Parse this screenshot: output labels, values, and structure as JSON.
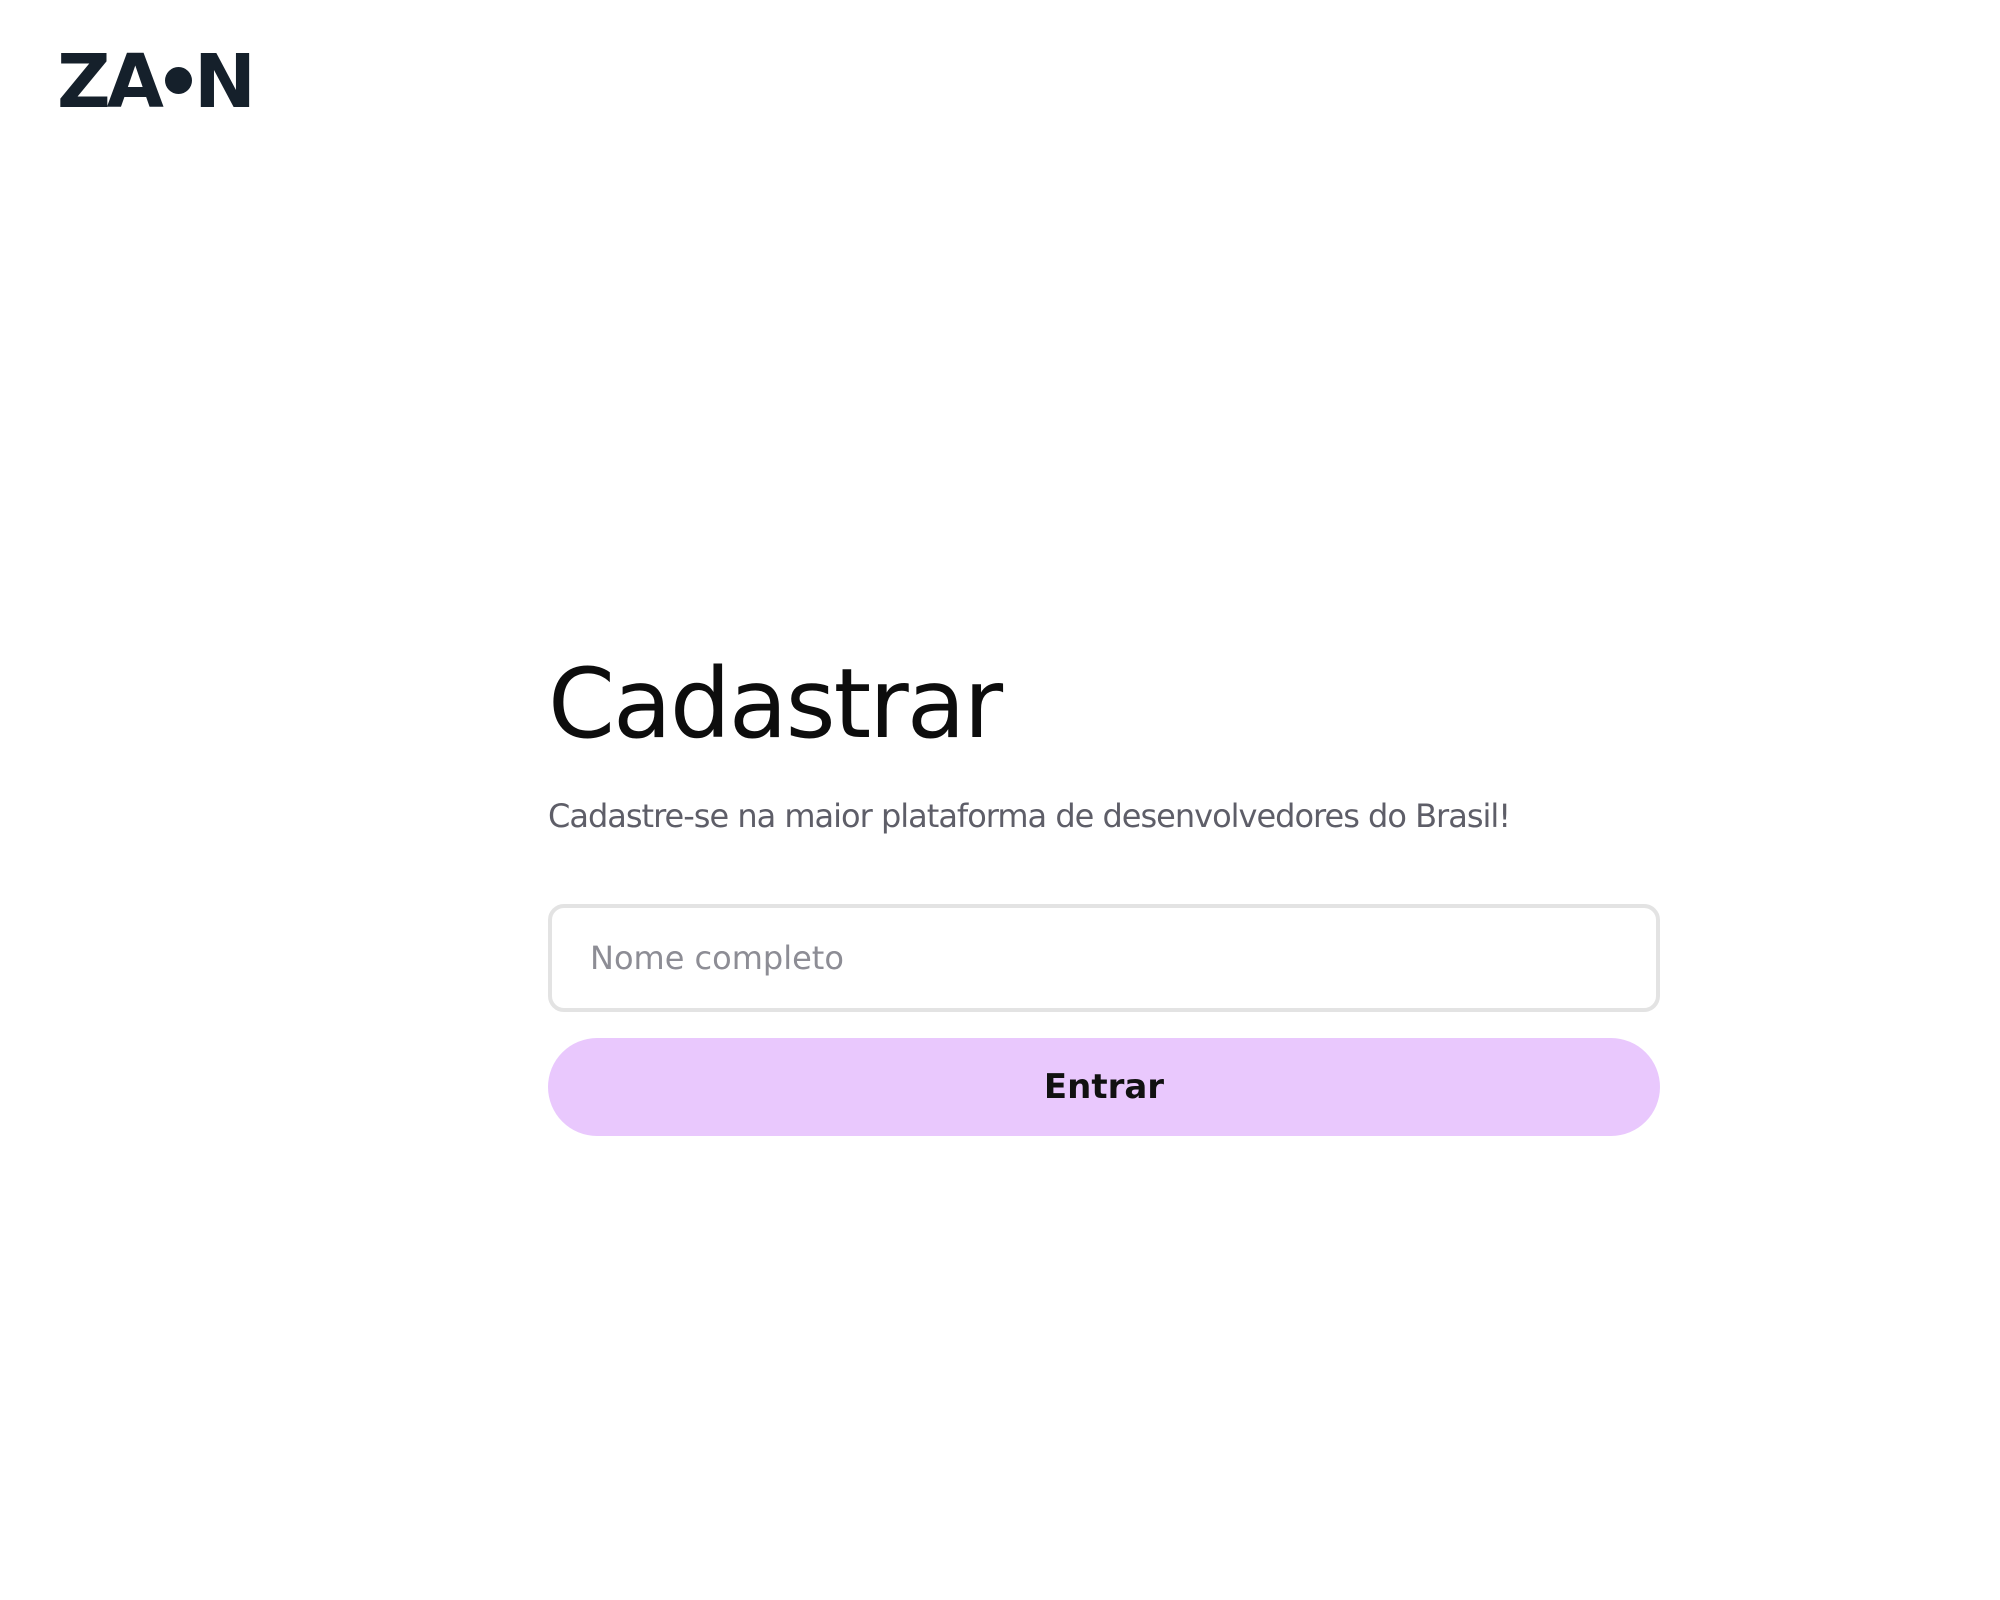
{
  "brand": {
    "logo_letters": [
      "ZA",
      "N"
    ],
    "logo_color": "#15202b"
  },
  "form": {
    "title": "Cadastrar",
    "subtitle": "Cadastre-se na maior plataforma de desenvolvedores do Brasil!",
    "name_field": {
      "value": "",
      "placeholder": "Nome completo"
    },
    "submit_label": "Entrar"
  },
  "colors": {
    "background": "#ffffff",
    "button_background": "#e9c8fd",
    "input_border": "#e3e3e3",
    "subtitle_text": "#5e5e68",
    "title_text": "#0d0d0d"
  }
}
